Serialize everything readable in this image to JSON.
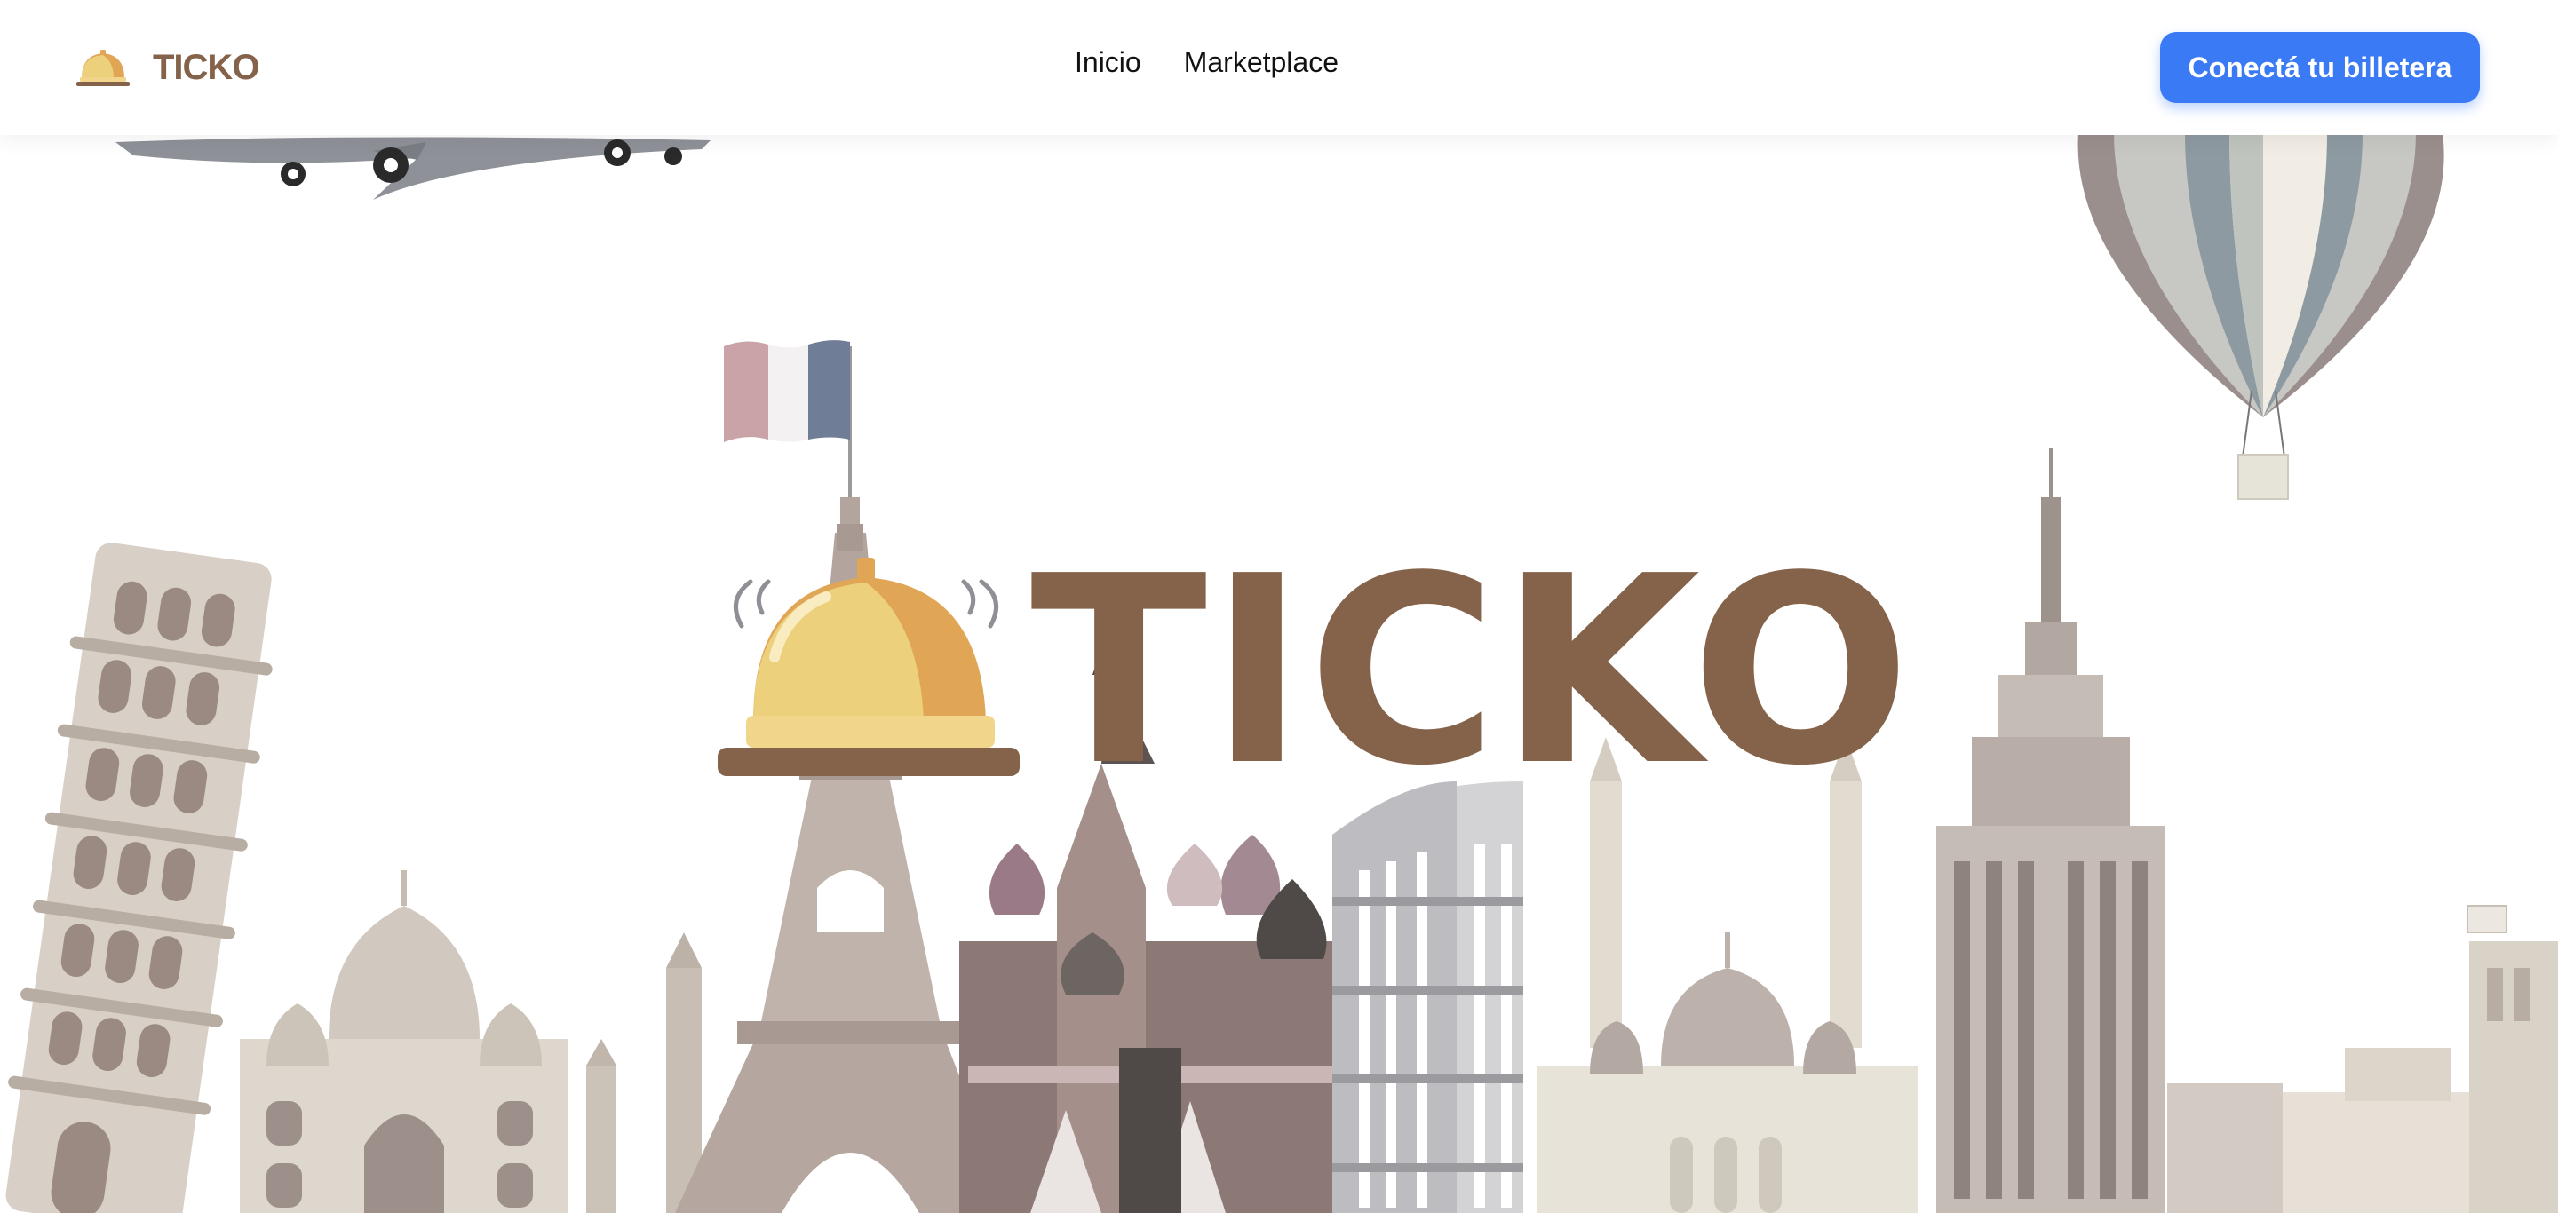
{
  "brand": {
    "name": "TICKO",
    "logo_icon": "service-bell-icon"
  },
  "nav": {
    "links": [
      {
        "label": "Inicio"
      },
      {
        "label": "Marketplace"
      }
    ]
  },
  "cta": {
    "label": "Conectá tu billetera"
  },
  "hero": {
    "title": "TICKO",
    "illustration": "world-landmarks-skyline",
    "icons": [
      "service-bell-icon",
      "airplane-icon",
      "hot-air-balloon-icon",
      "french-flag-icon"
    ]
  },
  "colors": {
    "brand_brown": "#85634a",
    "button_blue": "#3a7bf5",
    "bell_gold": "#ecd07c",
    "bell_orange": "#e0a656",
    "landmark_beige": "#cfc6bb",
    "landmark_mauve": "#9a8581"
  }
}
